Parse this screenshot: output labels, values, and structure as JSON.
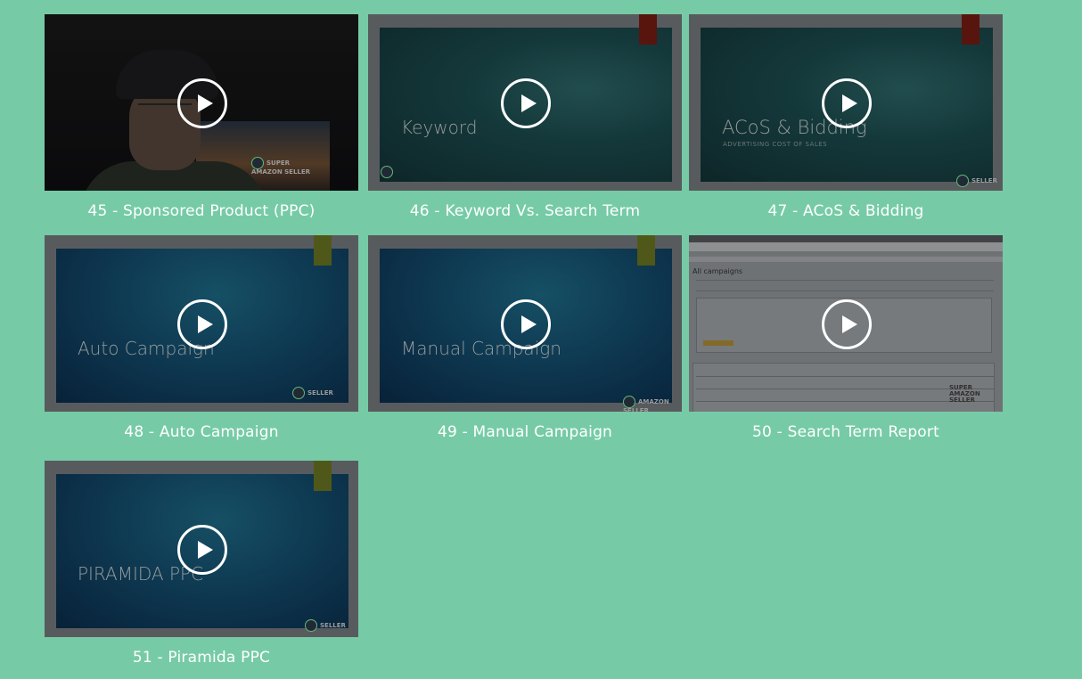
{
  "videos": [
    {
      "caption": "45 - Sponsored Product (PPC)",
      "slide_title": "",
      "slide_subtitle": "",
      "logo": "SUPER AMAZON SELLER",
      "kind": "webcam"
    },
    {
      "caption": "46 - Keyword Vs. Search Term",
      "slide_title": "Keyword",
      "slide_subtitle": "",
      "logo": "",
      "kind": "slide",
      "theme": "teal",
      "bookmark_color": "#7a1e14"
    },
    {
      "caption": "47 - ACoS & Bidding",
      "slide_title": "ACoS & Bidding",
      "slide_subtitle": "ADVERTISING COST OF SALES",
      "logo": "SELLER",
      "kind": "slide",
      "theme": "teal",
      "bookmark_color": "#7a1e14"
    },
    {
      "caption": "48 - Auto Campaign",
      "slide_title": "Auto Campaign",
      "slide_subtitle": "",
      "logo": "SELLER",
      "kind": "slide",
      "theme": "blue",
      "bookmark_color": "#6f7a23"
    },
    {
      "caption": "49 - Manual Campaign",
      "slide_title": "Manual Campaign",
      "slide_subtitle": "",
      "logo": "AMAZON SELLER",
      "kind": "slide",
      "theme": "blue",
      "bookmark_color": "#6f7a23"
    },
    {
      "caption": "50 - Search Term Report",
      "slide_title": "All campaigns",
      "slide_subtitle": "",
      "logo": "SUPER AMAZON SELLER",
      "kind": "screen"
    },
    {
      "caption": "51 - Piramida PPC",
      "slide_title": "PIRAMIDA PPC",
      "slide_subtitle": "",
      "logo": "SELLER",
      "kind": "slide",
      "theme": "blue",
      "bookmark_color": "#6f7a23"
    }
  ],
  "colors": {
    "background": "#76cba6",
    "caption_text": "#ffffff",
    "play_icon": "#ffffff"
  },
  "icons": {
    "play": "play-circle-icon"
  }
}
